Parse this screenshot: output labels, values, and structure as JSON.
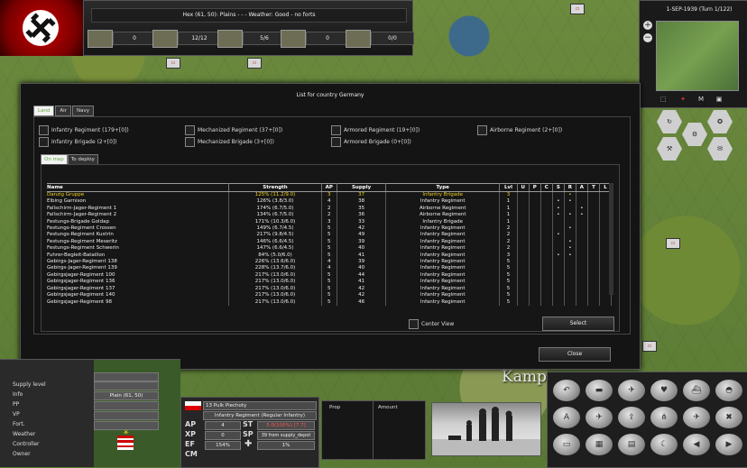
{
  "topbar": {
    "hex_info": "Hex (61, 50): Plains - - - Weather: Good - no forts",
    "counters": [
      "0",
      "12/12",
      "5/6",
      "0",
      "0/0"
    ]
  },
  "minimap": {
    "date": "1-SEP-1939 (Turn 1/122)",
    "zoom_in": "+",
    "zoom_out": "−",
    "mode_label": "M"
  },
  "dialog": {
    "title": "List for country Germany",
    "tabs": [
      "Land",
      "Air",
      "Navy"
    ],
    "filters": [
      "Infantry Regiment (179+[0])",
      "Mechanized Regiment (37+[0])",
      "Armored Regiment (19+[0])",
      "Airborne Regiment (2+[0])",
      "Infantry Brigade (2+[0])",
      "Mechanized Brigade (3+[0])",
      "Armored Brigade (0+[0])"
    ],
    "subtabs": [
      "On map",
      "To deploy"
    ],
    "columns": [
      "Name",
      "Strength",
      "AP",
      "Supply",
      "Type",
      "Lvl",
      "U",
      "P",
      "C",
      "S",
      "R",
      "A",
      "T",
      "L"
    ],
    "rows": [
      {
        "name": "Danzig Gruppe",
        "strength": "125% (11.2/9.0)",
        "ap": "3",
        "supply": "37",
        "type": "Infantry Brigade",
        "lvl": "3",
        "flags": [
          "",
          "",
          "",
          "",
          "•",
          "",
          "",
          ""
        ]
      },
      {
        "name": "Elbing Garnison",
        "strength": "126% (3.8/3.0)",
        "ap": "4",
        "supply": "38",
        "type": "Infantry Regiment",
        "lvl": "1",
        "flags": [
          "",
          "",
          "",
          "•",
          "•",
          "",
          "",
          ""
        ]
      },
      {
        "name": "Fallschirm-Jager-Regiment 1",
        "strength": "174% (6.7/5.0)",
        "ap": "2",
        "supply": "35",
        "type": "Airborne Regiment",
        "lvl": "1",
        "flags": [
          "",
          "",
          "",
          "•",
          "",
          "•",
          "",
          ""
        ]
      },
      {
        "name": "Fallschirm-Jager-Regiment 2",
        "strength": "134% (6.7/5.0)",
        "ap": "2",
        "supply": "36",
        "type": "Airborne Regiment",
        "lvl": "1",
        "flags": [
          "",
          "",
          "",
          "•",
          "•",
          "•",
          "",
          ""
        ]
      },
      {
        "name": "Festungs-Brigade Goldap",
        "strength": "171% (10.3/6.0)",
        "ap": "3",
        "supply": "33",
        "type": "Infantry Brigade",
        "lvl": "1",
        "flags": [
          "",
          "",
          "",
          "",
          "",
          "",
          "",
          ""
        ]
      },
      {
        "name": "Festungs-Regiment Crossen",
        "strength": "149% (6.7/4.5)",
        "ap": "5",
        "supply": "42",
        "type": "Infantry Regiment",
        "lvl": "2",
        "flags": [
          "",
          "",
          "",
          "",
          "•",
          "",
          "",
          ""
        ]
      },
      {
        "name": "Festungs-Regiment Kustrin",
        "strength": "217% (9.8/4.5)",
        "ap": "5",
        "supply": "49",
        "type": "Infantry Regiment",
        "lvl": "2",
        "flags": [
          "",
          "",
          "",
          "•",
          "",
          "",
          "",
          ""
        ]
      },
      {
        "name": "Festungs-Regiment Meseritz",
        "strength": "146% (6.6/4.5)",
        "ap": "5",
        "supply": "39",
        "type": "Infantry Regiment",
        "lvl": "2",
        "flags": [
          "",
          "",
          "",
          "",
          "•",
          "",
          "",
          ""
        ]
      },
      {
        "name": "Festungs-Regiment Schwerin",
        "strength": "147% (6.6/4.5)",
        "ap": "5",
        "supply": "40",
        "type": "Infantry Regiment",
        "lvl": "2",
        "flags": [
          "",
          "",
          "",
          "",
          "•",
          "",
          "",
          ""
        ]
      },
      {
        "name": "Fuhrer-Begleit-Bataillon",
        "strength": "84% (5.0/6.0)",
        "ap": "5",
        "supply": "41",
        "type": "Infantry Regiment",
        "lvl": "3",
        "flags": [
          "",
          "",
          "",
          "•",
          "•",
          "",
          "",
          ""
        ]
      },
      {
        "name": "Gebirgs-Jager-Regiment 138",
        "strength": "226% (13.6/6.0)",
        "ap": "4",
        "supply": "39",
        "type": "Infantry Regiment",
        "lvl": "5",
        "flags": [
          "",
          "",
          "",
          "",
          "",
          "",
          "",
          ""
        ]
      },
      {
        "name": "Gebirgs-Jager-Regiment 139",
        "strength": "228% (13.7/6.0)",
        "ap": "4",
        "supply": "40",
        "type": "Infantry Regiment",
        "lvl": "5",
        "flags": [
          "",
          "",
          "",
          "",
          "",
          "",
          "",
          ""
        ]
      },
      {
        "name": "Gebirgsjager-Regiment 100",
        "strength": "217% (13.0/6.0)",
        "ap": "5",
        "supply": "44",
        "type": "Infantry Regiment",
        "lvl": "5",
        "flags": [
          "",
          "",
          "",
          "",
          "",
          "",
          "",
          ""
        ]
      },
      {
        "name": "Gebirgsjager-Regiment 136",
        "strength": "217% (13.0/6.0)",
        "ap": "5",
        "supply": "41",
        "type": "Infantry Regiment",
        "lvl": "5",
        "flags": [
          "",
          "",
          "",
          "",
          "",
          "",
          "",
          ""
        ]
      },
      {
        "name": "Gebirgsjager-Regiment 137",
        "strength": "217% (13.0/6.0)",
        "ap": "5",
        "supply": "42",
        "type": "Infantry Regiment",
        "lvl": "5",
        "flags": [
          "",
          "",
          "",
          "",
          "",
          "",
          "",
          ""
        ]
      },
      {
        "name": "Gebirgsjager-Regiment 140",
        "strength": "217% (13.0/6.0)",
        "ap": "5",
        "supply": "42",
        "type": "Infantry Regiment",
        "lvl": "5",
        "flags": [
          "",
          "",
          "",
          "",
          "",
          "",
          "",
          ""
        ]
      },
      {
        "name": "Gebirgsjager-Regiment 98",
        "strength": "217% (13.0/6.0)",
        "ap": "5",
        "supply": "46",
        "type": "Infantry Regiment",
        "lvl": "5",
        "flags": [
          "",
          "",
          "",
          "",
          "",
          "",
          "",
          ""
        ]
      }
    ],
    "center_view": "Center View",
    "select_label": "Select",
    "close_label": "Close"
  },
  "info_panel": {
    "labels": [
      "Supply level",
      "Info",
      "PP",
      "VP",
      "Fort.",
      "Weather",
      "Controller",
      "Owner"
    ],
    "info_value": "Plain (61, 50)",
    "weather_icon": "☀"
  },
  "unit_card": {
    "name": "13 Pulk Piechoty",
    "type": "Infantry Regiment (Regular Infantry)",
    "ap_label": "AP",
    "ap_value": "4",
    "xp_label": "XP",
    "xp_value": "0",
    "ef_label": "EF",
    "ef_value": "154%",
    "cm_label": "CM",
    "st_label": "ST",
    "st_value": "5.0(100%) [7.7]",
    "sp_label": "SP",
    "sp_value": "39 from supply_depot",
    "plus_value": "1%"
  },
  "prop_panel": {
    "prop_header": "Prop",
    "amount_header": "Amount"
  },
  "map": {
    "label": "Kamp"
  },
  "colors": {
    "selected_row": "#f0d020",
    "active_tab_text": "#66aa44"
  }
}
